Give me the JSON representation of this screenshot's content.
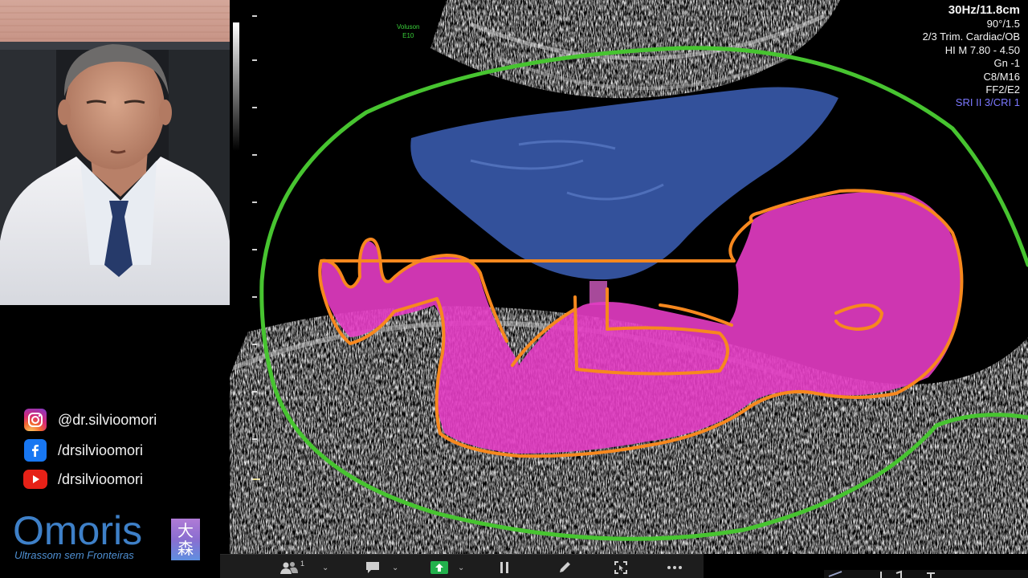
{
  "social": [
    {
      "platform": "instagram",
      "icon": "instagram-icon",
      "handle": "@dr.silvioomori",
      "color": "#e4405f"
    },
    {
      "platform": "facebook",
      "icon": "facebook-icon",
      "handle": "/drsilvioomori",
      "color": "#1877f2"
    },
    {
      "platform": "youtube",
      "icon": "youtube-icon",
      "handle": "/drsilvioomori",
      "color": "#e62117"
    }
  ],
  "logo": {
    "word": "Omoris",
    "tagline": "Ultrassom sem Fronteiras",
    "kanji_1": "大",
    "kanji_2": "森"
  },
  "ultrasound": {
    "brand": "Voluson",
    "model": "E10",
    "params": [
      "30Hz/11.8cm",
      "90°/1.5",
      "2/3 Trim. Cardiac/OB",
      "HI M  7.80 - 4.50",
      "Gn  -1",
      "C8/M16",
      "FF2/E2"
    ],
    "sri": "SRI II 3/CRI 1"
  },
  "toolbar": {
    "participants_count": "1",
    "items": [
      "participants-icon",
      "chat-icon",
      "share-screen-icon",
      "pause-icon",
      "annotate-icon",
      "remote-control-icon",
      "more-icon"
    ]
  },
  "colors": {
    "uterus_outline": "#47c430",
    "fetus_fill": "#e43cc4",
    "fetus_outline": "#f7881e",
    "placenta_fill": "#3a5cb0"
  }
}
